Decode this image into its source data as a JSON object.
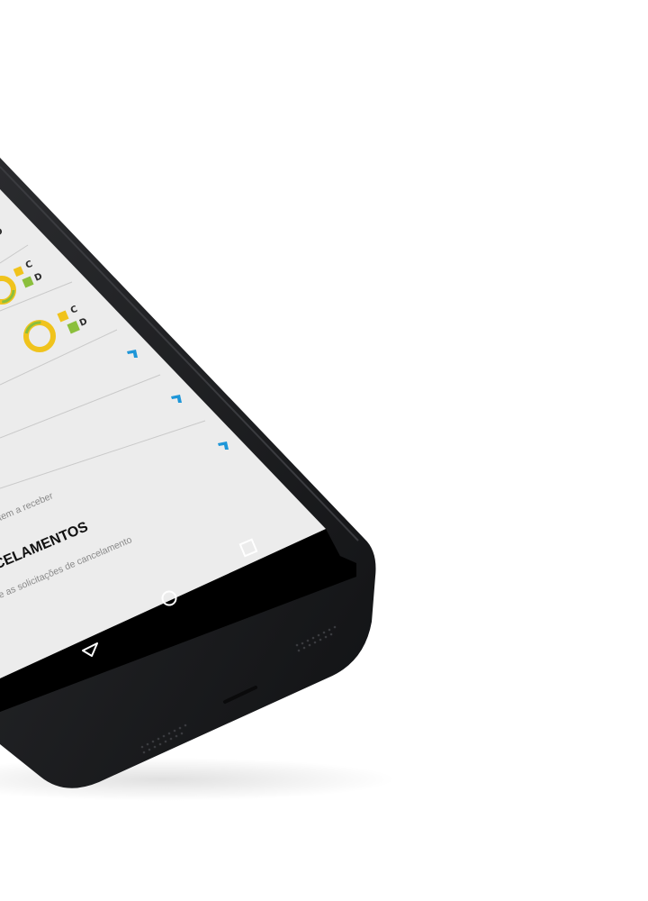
{
  "colors": {
    "accent_blue": "#1e96d8",
    "logo_yellow": "#f0c31c",
    "logo_green": "#8bbf3c",
    "device_body": "#1b1c1e",
    "screen_bg": "#ececec",
    "navbar_bg": "#000000"
  },
  "screen": {
    "logo_rows": [
      {
        "letter_top": "C",
        "letter_bottom": "D"
      },
      {
        "letter_top": "C",
        "letter_bottom": "D"
      }
    ],
    "menu_rows": [
      {
        "icon": "chevron-right-icon"
      },
      {
        "icon": "chevron-right-icon"
      },
      {
        "icon": "chevron-right-icon",
        "subtitle": "tem a receber"
      },
      {
        "title": "CELAMENTOS",
        "subtitle": "e as solicitações de cancelamento"
      }
    ],
    "top_fragment": "D"
  },
  "navigation_bar": {
    "back": "back-triangle-icon",
    "home": "home-circle-icon",
    "recents": "recents-square-icon"
  }
}
